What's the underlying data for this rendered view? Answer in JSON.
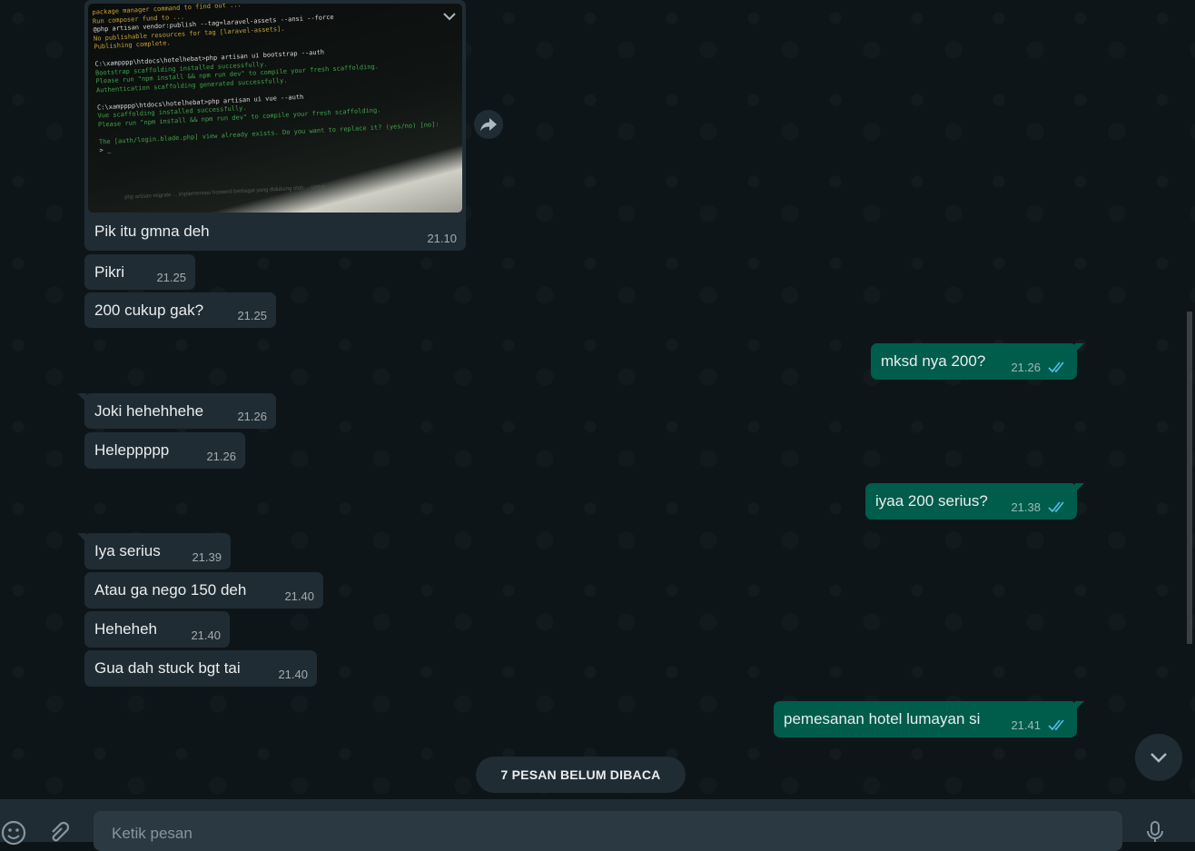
{
  "photo": {
    "terminal_lines": [
      {
        "text": "  package  manager   command  to  find  out  ...",
        "color": "#c8a13a"
      },
      {
        "text": "  Run  composer  fund  to  ...",
        "color": "#c8a13a"
      },
      {
        "text": "@php artisan vendor:publish --tag=laravel-assets --ansi --force",
        "color": "#d9d9d9"
      },
      {
        "text": "No publishable resources for tag [laravel-assets].",
        "color": "#c8a13a"
      },
      {
        "text": "Publishing complete.",
        "color": "#c8a13a"
      },
      {
        "text": "",
        "color": "#d9d9d9"
      },
      {
        "text": "C:\\xampppp\\htdocs\\hotelhebat>php artisan ui bootstrap --auth",
        "color": "#d9d9d9"
      },
      {
        "text": "Bootstrap scaffolding installed successfully.",
        "color": "#3fa34d"
      },
      {
        "text": "Please run \"npm install && npm run dev\" to compile your fresh scaffolding.",
        "color": "#3fa34d"
      },
      {
        "text": "Authentication scaffolding generated successfully.",
        "color": "#3fa34d"
      },
      {
        "text": "",
        "color": "#d9d9d9"
      },
      {
        "text": "C:\\xampppp\\htdocs\\hotelhebat>php artisan ui vue --auth",
        "color": "#d9d9d9"
      },
      {
        "text": "Vue scaffolding installed successfully.",
        "color": "#3fa34d"
      },
      {
        "text": "Please run \"npm install && npm run dev\" to compile your fresh scaffolding.",
        "color": "#3fa34d"
      },
      {
        "text": "",
        "color": "#d9d9d9"
      },
      {
        "text": "  The [auth/login.blade.php] view already exists. Do you want to replace it? (yes/no) [no]:",
        "color": "#3fa34d"
      },
      {
        "text": "  > _",
        "color": "#d9d9d9"
      }
    ],
    "screen_caption": "php artisan migrate     ... implementasi frontend berbagai yang didukung oleh ... Untuk"
  },
  "messages": [
    {
      "dir": "in",
      "text": "Pik itu gmna deh",
      "time": "21.10",
      "tail": true
    },
    {
      "dir": "in",
      "text": "Pikri",
      "time": "21.25",
      "tail": false
    },
    {
      "dir": "in",
      "text": "200 cukup gak?",
      "time": "21.25",
      "tail": false
    },
    {
      "dir": "out",
      "text": "mksd nya 200?",
      "time": "21.26",
      "tail": true
    },
    {
      "dir": "in",
      "text": "Joki hehehhehe",
      "time": "21.26",
      "tail": true
    },
    {
      "dir": "in",
      "text": "Heleppppp",
      "time": "21.26",
      "tail": false
    },
    {
      "dir": "out",
      "text": "iyaa 200 serius?",
      "time": "21.38",
      "tail": true
    },
    {
      "dir": "in",
      "text": "Iya serius",
      "time": "21.39",
      "tail": true
    },
    {
      "dir": "in",
      "text": "Atau ga nego 150 deh",
      "time": "21.40",
      "tail": false
    },
    {
      "dir": "in",
      "text": "Heheheh",
      "time": "21.40",
      "tail": false
    },
    {
      "dir": "in",
      "text": "Gua dah stuck bgt tai",
      "time": "21.40",
      "tail": false
    },
    {
      "dir": "out",
      "text": "pemesanan hotel lumayan si",
      "time": "21.41",
      "tail": true
    }
  ],
  "unread_banner": "7 PESAN BELUM DIBACA",
  "composer": {
    "placeholder": "Ketik pesan"
  },
  "icons": {
    "forward": "forward-icon",
    "menu_chevron": "chevron-down-icon",
    "scroll_down": "chevron-down-icon",
    "emoji": "emoji-icon",
    "attach": "attach-icon",
    "mic": "mic-icon",
    "read_receipt": "double-check-icon"
  },
  "colors": {
    "incoming": "#202c33",
    "outgoing": "#005c4b",
    "read_tick": "#53bdeb",
    "background": "#0e1519"
  }
}
